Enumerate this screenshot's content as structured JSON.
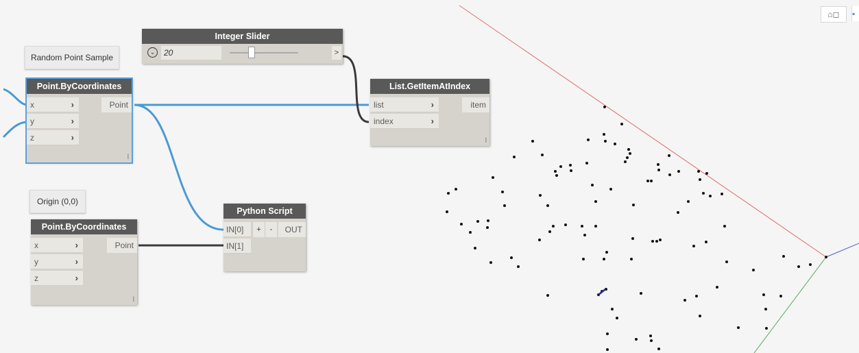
{
  "notes": {
    "random": "Random Point Sample",
    "origin": "Origin (0,0)"
  },
  "slider": {
    "title": "Integer Slider",
    "value": "20",
    "out": ">"
  },
  "point1": {
    "title": "Point.ByCoordinates",
    "inputs": [
      "x",
      "y",
      "z"
    ],
    "output": "Point",
    "lacing": "l"
  },
  "point2": {
    "title": "Point.ByCoordinates",
    "inputs": [
      "x",
      "y",
      "z"
    ],
    "output": "Point",
    "lacing": "l"
  },
  "getitem": {
    "title": "List.GetItemAtIndex",
    "inputs": [
      "list",
      "index"
    ],
    "output": "item",
    "lacing": "l"
  },
  "python": {
    "title": "Python Script",
    "inputs": [
      "IN[0]",
      "IN[1]"
    ],
    "add": "+",
    "remove": "-",
    "output": "OUT"
  },
  "icons": {
    "chevron": "chevron-right-icon",
    "dropdown": "chevron-down-circle-icon",
    "view_toggle": "3d-view-icon"
  },
  "colors": {
    "wire_selected": "#4a9ad4",
    "wire_default": "#3a3a3a",
    "axis_x": "#e36a6a",
    "axis_y": "#5aa55a",
    "axis_z": "#5a5ad6",
    "node_header": "#595959"
  }
}
